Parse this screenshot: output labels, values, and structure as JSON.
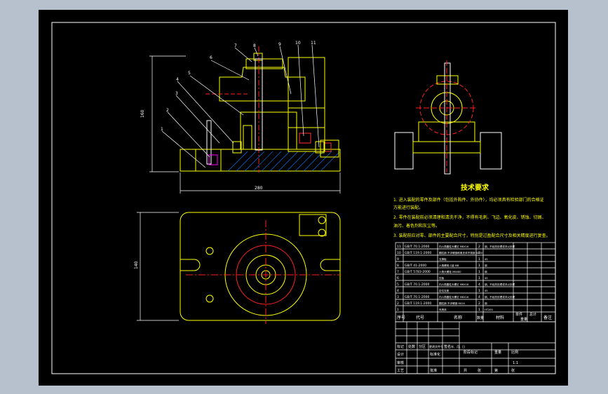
{
  "tech_requirements": {
    "title": "技术要求",
    "lines": [
      "1. 进入装配的零件及部件（包括外购件、外协件），均必须具有检验部门的合格证",
      "方能进行装配。",
      "2. 零件在装配前必须清理和清洗干净，不得有毛刺、飞边、氧化皮、锈蚀、切屑、",
      "油污、着色剂和灰尘等。",
      "3. 装配前应对零、部件的主要配合尺寸，特别是过盈配合尺寸及相关精度进行复查。"
    ]
  },
  "dimensions": {
    "front_height": "160",
    "front_width": "280",
    "top_height": "140"
  },
  "balloons": [
    "1",
    "2",
    "3",
    "4",
    "5",
    "6",
    "7",
    "8",
    "9",
    "10",
    "11"
  ],
  "bom": {
    "headers": [
      "序号",
      "代号",
      "名称",
      "数量",
      "材料",
      "单件",
      "总计",
      "备注"
    ],
    "weight_header": "重量",
    "rows": [
      {
        "no": "11",
        "code": "GB/T 70.1-2000",
        "name": "内六角圆柱头螺钉 M8X16",
        "qty": "2",
        "mat": "钢，不经热处理或淬火处理"
      },
      {
        "no": "10",
        "code": "GB/T 119.1-2000",
        "name": "圆柱销 不淬硬钢和奥氏体不锈钢 6X20",
        "qty": "2",
        "mat": ""
      },
      {
        "no": "9",
        "code": "",
        "name": "支撑板",
        "qty": "1",
        "mat": "45"
      },
      {
        "no": "8",
        "code": "GB/T 41-2000",
        "name": "六角螺母-C级 M8",
        "qty": "1",
        "mat": "钢"
      },
      {
        "no": "7",
        "code": "GB/T 5783-2000",
        "name": "六角头螺栓 M8X80",
        "qty": "1",
        "mat": "钢"
      },
      {
        "no": "6",
        "code": "",
        "name": "压板",
        "qty": "1",
        "mat": "45"
      },
      {
        "no": "5",
        "code": "GB/T 70.1-2000",
        "name": "内六角圆柱头螺钉 M6X16",
        "qty": "4",
        "mat": "钢，不经热处理或淬火处理"
      },
      {
        "no": "4",
        "code": "",
        "name": "定位支座",
        "qty": "1",
        "mat": "45"
      },
      {
        "no": "3",
        "code": "GB/T 70.1-2000",
        "name": "内六角圆柱头螺钉 M6X16",
        "qty": "4",
        "mat": "钢，不经热处理或淬火处理"
      },
      {
        "no": "2",
        "code": "GB/T 119.1-2000",
        "name": "圆柱销 不淬硬钢 6X24",
        "qty": "2",
        "mat": "钢"
      },
      {
        "no": "1",
        "code": "",
        "name": "夹具体",
        "qty": "1",
        "mat": "HT200"
      }
    ]
  },
  "title_block": {
    "marks": [
      "标记",
      "处数",
      "分区",
      "更改文件号",
      "签名",
      "年、月、日"
    ],
    "roles": [
      "设计",
      "审核",
      "工艺"
    ],
    "std": "标准化",
    "batch": "批准",
    "stage": "阶段标记",
    "weight": "重量",
    "scale": "比例",
    "scale_val": "1:1",
    "sheets": [
      "共",
      "张",
      "第",
      "张"
    ]
  },
  "colors": {
    "sheet": "#000000",
    "frame": "#ffffff",
    "part": "#ffff00",
    "axis": "#ff2020",
    "balloon": "#ffffff",
    "text": "#ffffff",
    "bg": "#b7c1cd"
  }
}
